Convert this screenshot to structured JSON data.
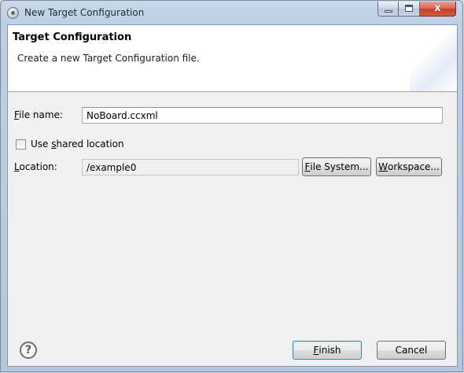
{
  "window": {
    "title": "New Target Configuration",
    "close_glyph": "x"
  },
  "header": {
    "title": "Target Configuration",
    "description": "Create a new Target Configuration file."
  },
  "form": {
    "file_name": {
      "label_mnemonic": "F",
      "label_rest": "ile name:",
      "value": "NoBoard.ccxml"
    },
    "shared_location": {
      "label_pre": "Use ",
      "label_mnemonic": "s",
      "label_rest": "hared location",
      "checked": false
    },
    "location": {
      "label_mnemonic": "L",
      "label_rest": "ocation:",
      "value": "/example0"
    },
    "file_system_button": {
      "mnemonic": "F",
      "rest": "ile System..."
    },
    "workspace_button": {
      "mnemonic": "W",
      "rest": "orkspace..."
    }
  },
  "footer": {
    "help_glyph": "?",
    "finish_button": {
      "mnemonic": "F",
      "rest": "inish"
    },
    "cancel_button": {
      "label": "Cancel"
    }
  }
}
